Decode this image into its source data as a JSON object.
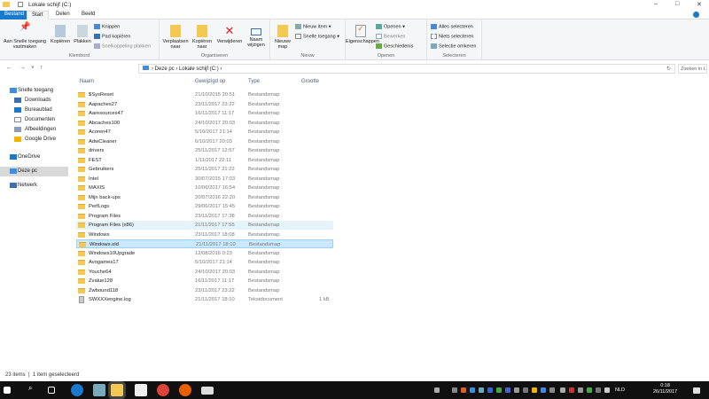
{
  "window": {
    "title": "Lokale schijf (C:)"
  },
  "tabs": [
    "Bestand",
    "Start",
    "Delen",
    "Beeld"
  ],
  "ribbon": {
    "klembord": {
      "label": "Klembord",
      "pin": "Aan Snelle toegang vastmaken",
      "copy": "Kopiëren",
      "paste": "Plakken",
      "cut": "Knippen",
      "copy_path": "Pad kopiëren",
      "paste_shortcut": "Snelkoppeling plakken"
    },
    "organiseren": {
      "label": "Organiseren",
      "move": "Verplaatsen naar",
      "copy_to": "Kopiëren naar",
      "delete": "Verwijderen",
      "rename": "Naam wijzigen"
    },
    "nieuw": {
      "label": "Nieuw",
      "new_folder": "Nieuwe map",
      "new_item": "Nieuw item ▾",
      "easy_access": "Snelle toegang ▾"
    },
    "openen": {
      "label": "Openen",
      "properties": "Eigenschappen",
      "open": "Openen ▾",
      "edit": "Bewerken",
      "history": "Geschiedenis"
    },
    "selecteren": {
      "label": "Selecteren",
      "select_all": "Alles selecteren",
      "select_none": "Niets selecteren",
      "invert": "Selectie omkeren"
    }
  },
  "address": {
    "crumbs": [
      "Deze pc",
      "Lokale schijf (C:)"
    ],
    "search_placeholder": "Zoeken in Lokale schi... ⌕"
  },
  "sidebar": [
    "Snelle toegang",
    "Downloads",
    "Bureaublad",
    "Documenten",
    "Afbeeldingen",
    "Google Drive",
    "OneDrive",
    "Deze pc",
    "Netwerk"
  ],
  "columns": [
    "Naam",
    "Gewijzigd op",
    "Type",
    "Grootte"
  ],
  "files": [
    {
      "name": "$SysReset",
      "date": "21/10/2015 20:51",
      "type": "Bestandsmap",
      "size": ""
    },
    {
      "name": "Aapaches27",
      "date": "23/11/2017 23:22",
      "type": "Bestandsmap",
      "size": ""
    },
    {
      "name": "Aaresources47",
      "date": "16/11/2017 11:17",
      "type": "Bestandsmap",
      "size": ""
    },
    {
      "name": "Abcaches100",
      "date": "24/10/2017 20:03",
      "type": "Bestandsmap",
      "size": ""
    },
    {
      "name": "Acoren47",
      "date": "5/10/2017 21:14",
      "type": "Bestandsmap",
      "size": ""
    },
    {
      "name": "AdwCleaner",
      "date": "6/10/2017 20:03",
      "type": "Bestandsmap",
      "size": ""
    },
    {
      "name": "drivers",
      "date": "25/11/2017 12:57",
      "type": "Bestandsmap",
      "size": ""
    },
    {
      "name": "FEST",
      "date": "1/11/2017 22:11",
      "type": "Bestandsmap",
      "size": ""
    },
    {
      "name": "Gebruikers",
      "date": "25/11/2017 21:22",
      "type": "Bestandsmap",
      "size": ""
    },
    {
      "name": "Intel",
      "date": "30/07/2015 17:03",
      "type": "Bestandsmap",
      "size": ""
    },
    {
      "name": "MAXIS",
      "date": "10/06/2017 16:54",
      "type": "Bestandsmap",
      "size": ""
    },
    {
      "name": "Mijn back-ups",
      "date": "20/07/2016 22:20",
      "type": "Bestandsmap",
      "size": ""
    },
    {
      "name": "PerfLogs",
      "date": "29/06/2017 15:45",
      "type": "Bestandsmap",
      "size": ""
    },
    {
      "name": "Program Files",
      "date": "23/11/2017 17:38",
      "type": "Bestandsmap",
      "size": ""
    },
    {
      "name": "Program Files (x86)",
      "date": "21/11/2017 17:55",
      "type": "Bestandsmap",
      "size": ""
    },
    {
      "name": "Windows",
      "date": "23/11/2017 18:08",
      "type": "Bestandsmap",
      "size": ""
    },
    {
      "name": "Windows.old",
      "date": "21/11/2017 18:10",
      "type": "Bestandsmap",
      "size": ""
    },
    {
      "name": "Windows10Upgrade",
      "date": "12/08/2016 0:23",
      "type": "Bestandsmap",
      "size": ""
    },
    {
      "name": "Avogames17",
      "date": "5/10/2017 21:14",
      "type": "Bestandsmap",
      "size": ""
    },
    {
      "name": "Youche64",
      "date": "24/10/2017 20:03",
      "type": "Bestandsmap",
      "size": ""
    },
    {
      "name": "Zvalue128",
      "date": "16/11/2017 11:17",
      "type": "Bestandsmap",
      "size": ""
    },
    {
      "name": "Zwbound118",
      "date": "23/11/2017 23:22",
      "type": "Bestandsmap",
      "size": ""
    },
    {
      "name": "SWXXXengine.log",
      "date": "21/11/2017 18:10",
      "type": "Tekstdocument",
      "size": "1 kB"
    }
  ],
  "status": {
    "count": "23 items",
    "selected": "1 item geselecteerd"
  },
  "taskbar": {
    "time": "0:18",
    "date": "26/11/2017",
    "lang": "NLD"
  }
}
